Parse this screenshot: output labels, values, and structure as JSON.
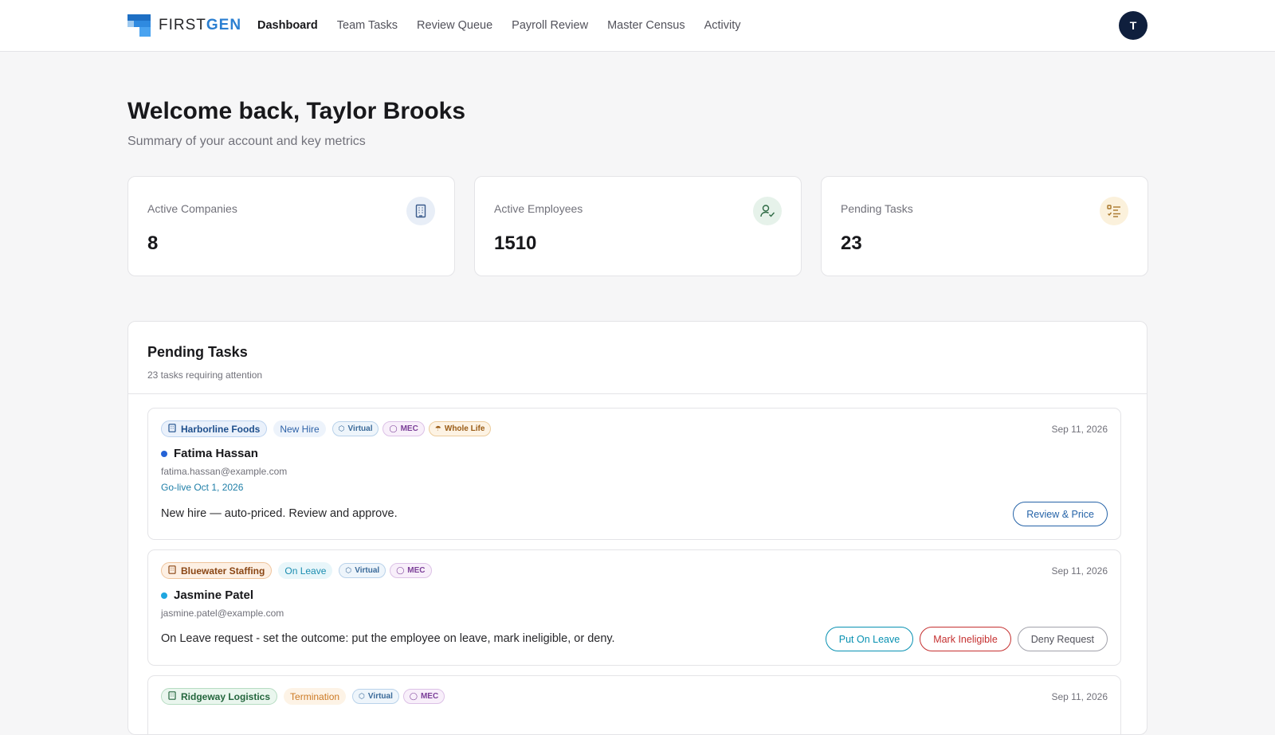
{
  "brand": {
    "first": "FIRST",
    "gen": "GEN",
    "accent": "#2b7fd1"
  },
  "nav": {
    "items": [
      {
        "label": "Dashboard",
        "active": true
      },
      {
        "label": "Team Tasks",
        "active": false
      },
      {
        "label": "Review Queue",
        "active": false
      },
      {
        "label": "Payroll Review",
        "active": false
      },
      {
        "label": "Master Census",
        "active": false
      },
      {
        "label": "Activity",
        "active": false
      }
    ],
    "avatar_initial": "T"
  },
  "header": {
    "title": "Welcome back, Taylor Brooks",
    "subtitle": "Summary of your account and key metrics"
  },
  "metrics": [
    {
      "label": "Active Companies",
      "value": "8",
      "icon": "building-icon"
    },
    {
      "label": "Active Employees",
      "value": "1510",
      "icon": "user-check-icon"
    },
    {
      "label": "Pending Tasks",
      "value": "23",
      "icon": "list-checks-icon"
    }
  ],
  "pending": {
    "title": "Pending Tasks",
    "subtitle": "23 tasks requiring attention",
    "tasks": [
      {
        "company": "Harborline Foods",
        "type": "New Hire",
        "tags": [
          "Virtual",
          "MEC",
          "Whole Life"
        ],
        "date": "Sep 11, 2026",
        "name": "Fatima Hassan",
        "email": "fatima.hassan@example.com",
        "golive": "Go-live Oct 1, 2026",
        "description": "New hire — auto-priced. Review and approve.",
        "actions": [
          "Review & Price"
        ]
      },
      {
        "company": "Bluewater Staffing",
        "type": "On Leave",
        "tags": [
          "Virtual",
          "MEC"
        ],
        "date": "Sep 11, 2026",
        "name": "Jasmine Patel",
        "email": "jasmine.patel@example.com",
        "description": "On Leave request - set the outcome: put the employee on leave, mark ineligible, or deny.",
        "actions": [
          "Put On Leave",
          "Mark Ineligible",
          "Deny Request"
        ]
      },
      {
        "company": "Ridgeway Logistics",
        "type": "Termination",
        "tags": [
          "Virtual",
          "MEC"
        ],
        "date": "Sep 11, 2026"
      }
    ]
  }
}
